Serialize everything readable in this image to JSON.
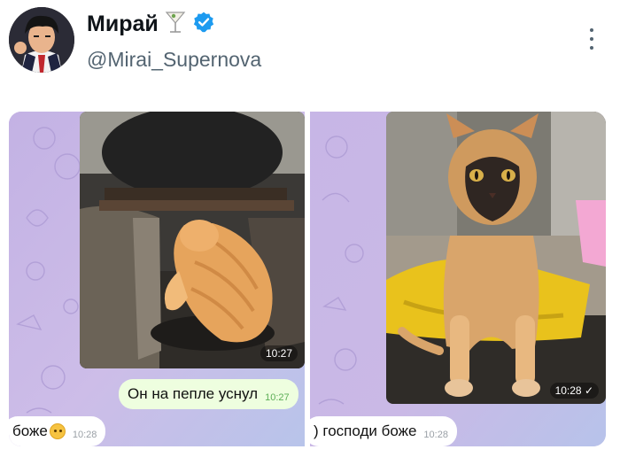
{
  "tweet": {
    "author_name": "Мирай",
    "handle": "@Mirai_Supernova",
    "name_emoji": "cocktail-glass-icon",
    "verified_icon": "verified-badge-icon",
    "menu_icon": "more-vertical-icon",
    "verified_color": "#1d9bf0"
  },
  "chat_left": {
    "photo_time": "10:27",
    "outgoing_text": "Он на пепле уснул",
    "outgoing_time": "10:27",
    "incoming_text": "боже",
    "incoming_emoji": "smiling-face-icon",
    "incoming_time": "10:28"
  },
  "chat_right": {
    "photo_time": "10:28 ✓",
    "incoming_text": ") господи боже",
    "incoming_time": "10:28"
  }
}
